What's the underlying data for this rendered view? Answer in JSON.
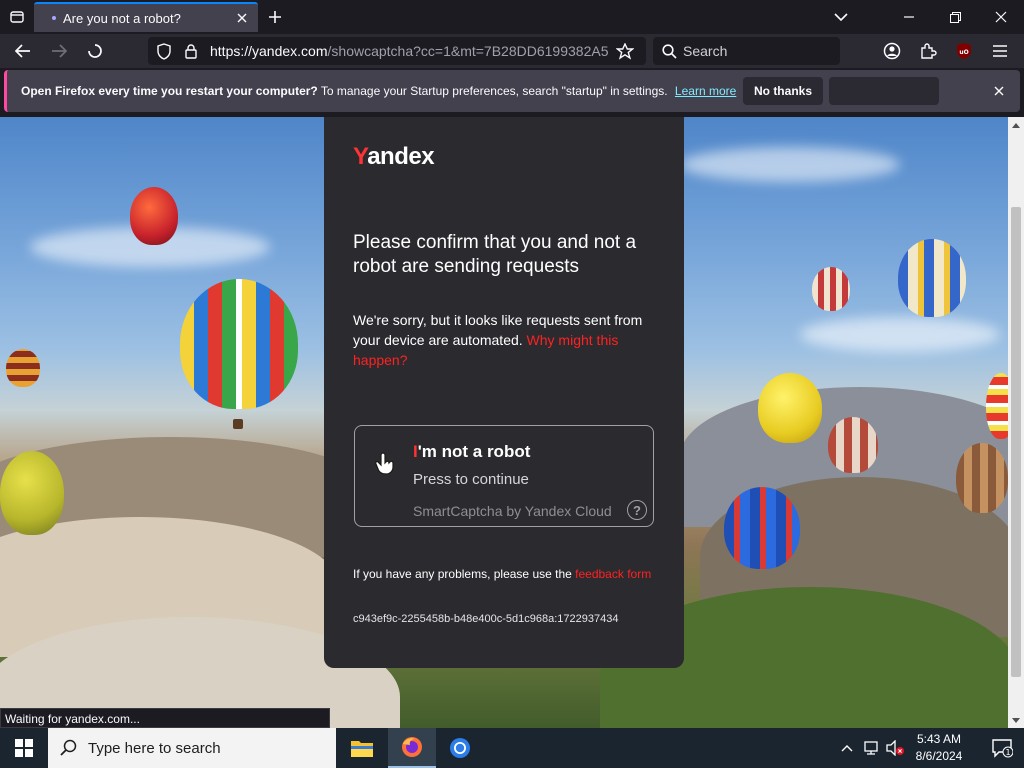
{
  "browser": {
    "tab": {
      "title": "Are you not a robot?"
    },
    "url": {
      "host": "https://yandex.com",
      "path": "/showcaptcha?cc=1&mt=7B28DD6199382A5"
    },
    "search_label": "Search",
    "notification": {
      "bold": "Open Firefox every time you restart your computer?",
      "text": "To manage your Startup preferences, search \"startup\" in settings.",
      "link": "Learn more",
      "button": "No thanks"
    },
    "status": "Waiting for yandex.com..."
  },
  "captcha": {
    "logo_first": "Y",
    "logo_rest": "andex",
    "heading": "Please confirm that you and not a robot are sending requests",
    "description": "We're sorry, but it looks like requests sent from your device are automated.",
    "why_link": "Why might this happen?",
    "checkbox": {
      "title_first": "I",
      "title_rest": "'m not a robot",
      "subtitle": "Press to continue",
      "brand": "SmartCaptcha by Yandex Cloud",
      "help": "?"
    },
    "problem_text": "If you have any problems, please use the",
    "feedback_link": "feedback form",
    "token": "c943ef9c-2255458b-b48e400c-5d1c968a:1722937434"
  },
  "taskbar": {
    "search_placeholder": "Type here to search",
    "time": "5:43 AM",
    "date": "8/6/2024",
    "notification_count": "1"
  },
  "colors": {
    "accent": "#0a84ff",
    "yandex_red": "#ff3333",
    "card_bg": "#2a2a2f",
    "link_cyan": "#80ebff"
  }
}
